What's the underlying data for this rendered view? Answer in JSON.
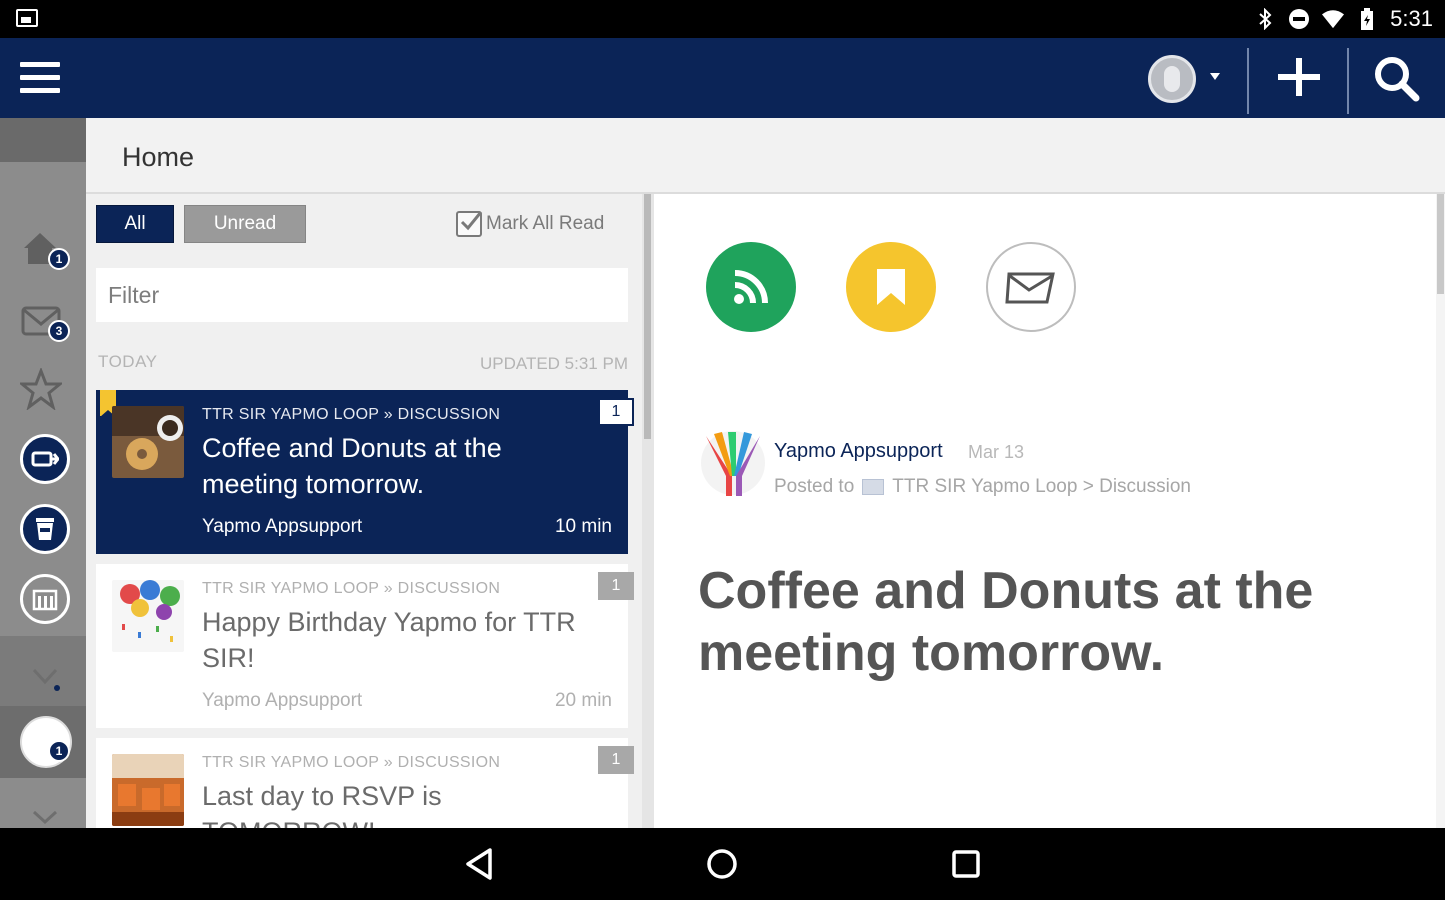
{
  "status_bar": {
    "time": "5:31"
  },
  "app_bar": {
    "menu_icon": "hamburger-menu-icon",
    "avatar_icon": "user-avatar-icon",
    "add_icon": "plus-icon",
    "search_icon": "search-icon",
    "background": "#0b2457"
  },
  "rail": {
    "items": [
      {
        "icon": "home-icon",
        "badge": "1"
      },
      {
        "icon": "mail-icon",
        "badge": "3"
      },
      {
        "icon": "star-icon",
        "badge": ""
      },
      {
        "icon": "loop-icon",
        "badge": ""
      },
      {
        "icon": "cup-icon",
        "badge": ""
      },
      {
        "icon": "building-icon",
        "badge": ""
      }
    ],
    "community_badge": "1"
  },
  "home": {
    "title": "Home"
  },
  "list": {
    "filters": {
      "all": "All",
      "unread": "Unread"
    },
    "mark_all_read": "Mark All Read",
    "filter_placeholder": "Filter",
    "section_label": "TODAY",
    "updated_label": "UPDATED 5:31 PM",
    "items": [
      {
        "meta": "TTR SIR YAPMO LOOP » DISCUSSION",
        "title": "Coffee and Donuts at the meeting tomorrow.",
        "author": "Yapmo Appsupport",
        "time": "10 min",
        "count": "1",
        "selected": true
      },
      {
        "meta": "TTR SIR YAPMO LOOP » DISCUSSION",
        "title": "Happy Birthday Yapmo for TTR SIR!",
        "author": "Yapmo Appsupport",
        "time": "20 min",
        "count": "1",
        "selected": false
      },
      {
        "meta": "TTR SIR YAPMO LOOP » DISCUSSION",
        "title": "Last day to RSVP is TOMORROW!",
        "author": "",
        "time": "",
        "count": "1",
        "selected": false
      }
    ]
  },
  "detail": {
    "actions": [
      {
        "icon": "rss-icon",
        "color": "#1fa35c"
      },
      {
        "icon": "bookmark-icon",
        "color": "#f5c52d"
      },
      {
        "icon": "envelope-icon",
        "color": "#ffffff"
      }
    ],
    "author": "Yapmo Appsupport",
    "date": "Mar 13",
    "posted_to_label": "Posted to",
    "posted_to_path": "TTR SIR Yapmo Loop > Discussion",
    "title": "Coffee and Donuts at the meeting tomorrow."
  },
  "nav": {
    "back_icon": "back-triangle-icon",
    "home_icon": "home-circle-icon",
    "recents_icon": "recents-square-icon"
  }
}
